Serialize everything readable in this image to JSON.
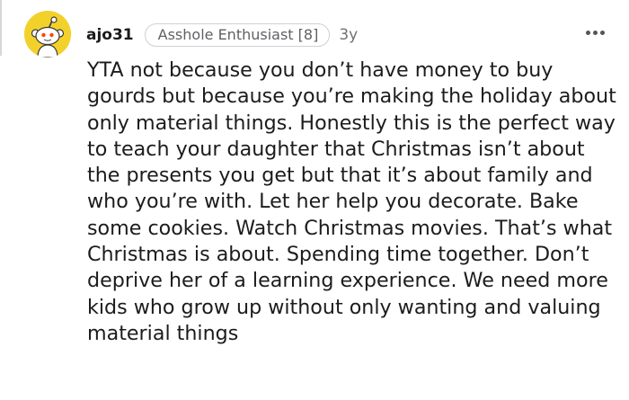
{
  "comment": {
    "username": "ajo31",
    "flair": "Asshole Enthusiast [8]",
    "age": "3y",
    "avatar_icon": "snoo-avatar-icon",
    "avatar_color": "#f3d12b",
    "more_icon": "more-options-icon",
    "body": "YTA not because you don’t have money to buy gourds but because you’re making the holiday about only material things. Honestly this is the perfect way to teach your daughter that Christmas isn’t about the presents you get but that it’s about family and who you’re with. Let her help you decorate. Bake some cookies. Watch Christmas movies. That’s what Christmas is about. Spending time together. Don’t deprive her of a learning experience. We need more kids who grow up without only wanting and valuing material things"
  }
}
